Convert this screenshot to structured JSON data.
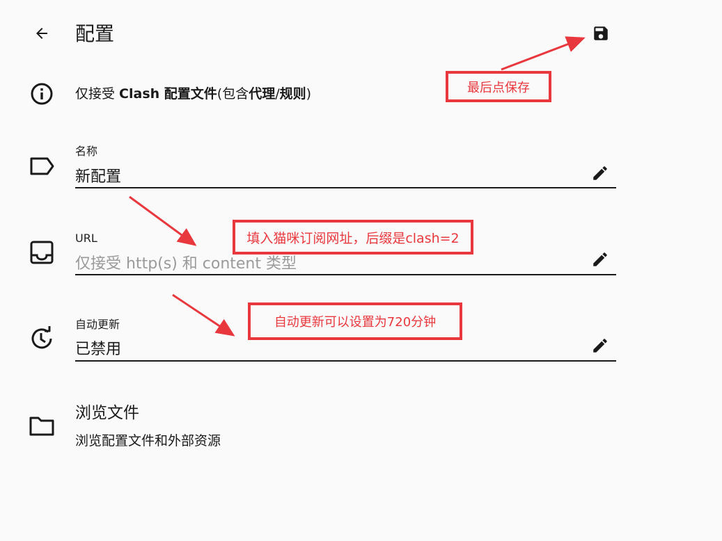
{
  "header": {
    "title": "配置"
  },
  "info": {
    "prefix": "仅接受 ",
    "b1": "Clash 配置文件",
    "mid1": "(包含",
    "b2": "代理",
    "slash": "/",
    "b3": "规则",
    "suffix": ")"
  },
  "fields": {
    "name": {
      "label": "名称",
      "value": "新配置"
    },
    "url": {
      "label": "URL",
      "placeholder": "仅接受 http(s) 和 content 类型"
    },
    "auto_update": {
      "label": "自动更新",
      "value": "已禁用"
    }
  },
  "browse": {
    "title": "浏览文件",
    "subtitle": "浏览配置文件和外部资源"
  },
  "annotations": {
    "save_note": "最后点保存",
    "url_note": "填入猫咪订阅网址，后缀是clash=2",
    "update_note": "自动更新可以设置为720分钟"
  },
  "icons": {
    "back": "arrow-back-icon",
    "save": "save-icon",
    "info": "info-icon",
    "name": "label-icon",
    "url": "inbox-icon",
    "auto_update": "update-icon",
    "edit": "pencil-icon",
    "browse": "folder-icon"
  },
  "colors": {
    "annotation": "#e8383d",
    "background": "#fafafa",
    "text": "#1a1a1a",
    "placeholder": "#9a9a9a"
  }
}
